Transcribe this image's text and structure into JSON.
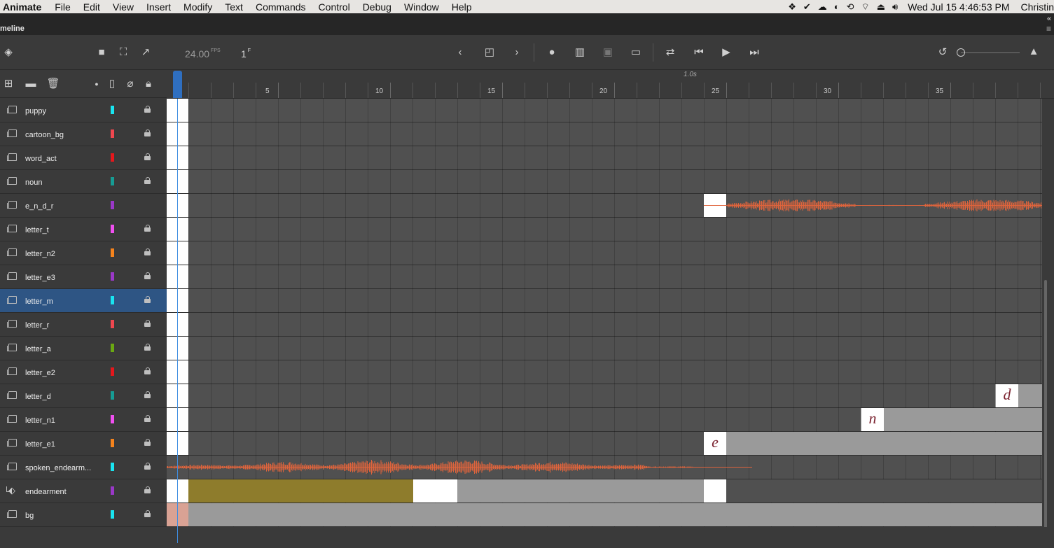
{
  "menubar": {
    "app": "Animate",
    "menus": [
      "File",
      "Edit",
      "View",
      "Insert",
      "Modify",
      "Text",
      "Commands",
      "Control",
      "Debug",
      "Window",
      "Help"
    ],
    "clock": "Wed Jul 15  4:46:53 PM",
    "user": "Christin"
  },
  "panel": {
    "title": "meline"
  },
  "toolbar": {
    "fps": "24.00",
    "fps_unit": "FPS",
    "frame": "1",
    "frame_unit": "F"
  },
  "ruler": {
    "one_sec": "1.0s",
    "labels": [
      "5",
      "10",
      "15",
      "20",
      "25",
      "30",
      "35"
    ]
  },
  "layers": [
    {
      "name": "puppy",
      "color": "#19e4f0",
      "locked": true
    },
    {
      "name": "cartoon_bg",
      "color": "#f0474f",
      "locked": true
    },
    {
      "name": "word_act",
      "color": "#e5171c",
      "locked": true
    },
    {
      "name": "noun",
      "color": "#169c94",
      "locked": true
    },
    {
      "name": "e_n_d_r",
      "color": "#9a38c8",
      "locked": false
    },
    {
      "name": "letter_t",
      "color": "#f04ff0",
      "locked": true
    },
    {
      "name": "letter_n2",
      "color": "#f5831c",
      "locked": true
    },
    {
      "name": "letter_e3",
      "color": "#9a38c8",
      "locked": true
    },
    {
      "name": "letter_m",
      "color": "#19e4f0",
      "locked": true,
      "selected": true
    },
    {
      "name": "letter_r",
      "color": "#f0474f",
      "locked": true
    },
    {
      "name": "letter_a",
      "color": "#6aa812",
      "locked": true
    },
    {
      "name": "letter_e2",
      "color": "#e5171c",
      "locked": true
    },
    {
      "name": "letter_d",
      "color": "#169c94",
      "locked": true
    },
    {
      "name": "letter_n1",
      "color": "#f04ff0",
      "locked": true
    },
    {
      "name": "letter_e1",
      "color": "#f5831c",
      "locked": true
    },
    {
      "name": "spoken_endearm...",
      "color": "#19e4f0",
      "locked": true
    },
    {
      "name": "endearment",
      "color": "#9a38c8",
      "locked": true,
      "tween": true
    },
    {
      "name": "bg",
      "color": "#19e4f0",
      "locked": true
    }
  ],
  "letters": {
    "d": "d",
    "n": "n",
    "e": "e"
  },
  "colors": {
    "waveform": "#e0643c",
    "olive": "#8e7c2c",
    "bg_key": "#d9a294",
    "selected_row": "#2e5584",
    "playhead": "#2f6fc0"
  }
}
